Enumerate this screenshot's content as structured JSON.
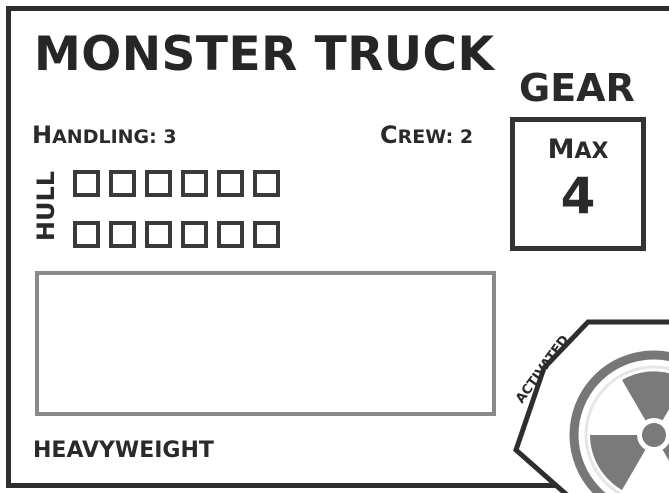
{
  "card": {
    "title": "MONSTER TRUCK",
    "handling": {
      "label_first": "H",
      "label_rest": "ANDLING: 3"
    },
    "crew": {
      "label_first": "C",
      "label_rest": "REW: 2"
    },
    "hull": {
      "label": "HULL",
      "rows": 2,
      "boxes_per_row": 6
    },
    "trait": "HEAVYWEIGHT",
    "gear": {
      "title": "GEAR",
      "max_first": "M",
      "max_rest": "AX",
      "value": "4"
    },
    "activated": {
      "label": "ACTIVATED",
      "icon": "radiation-icon"
    }
  },
  "colors": {
    "ink": "#2b2b2b",
    "notes_border": "#8a8a8a",
    "hazard_ring": "#777777",
    "background": "#ffffff"
  }
}
